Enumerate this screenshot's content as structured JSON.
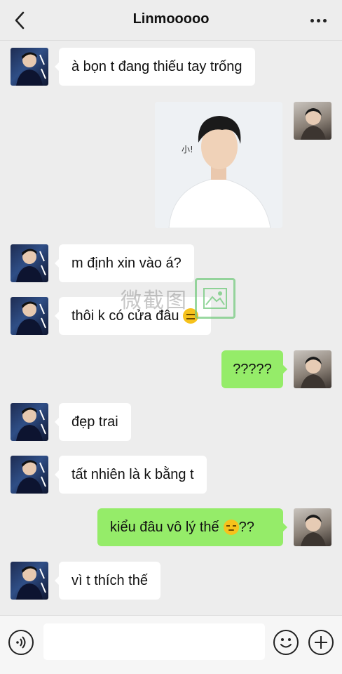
{
  "header": {
    "title": "Linmooooo"
  },
  "messages": [
    {
      "side": "left",
      "text": "à bọn t đang thiếu tay trống"
    },
    {
      "side": "right",
      "type": "image",
      "caption_in_image": "小!"
    },
    {
      "side": "left",
      "text": "m định xin vào á?"
    },
    {
      "side": "left",
      "text": "thôi k có cửa đâu",
      "emoji": "neutral-face"
    },
    {
      "side": "right",
      "text": "?????"
    },
    {
      "side": "left",
      "text": "đẹp trai"
    },
    {
      "side": "left",
      "text": "tất nhiên là k bằng t"
    },
    {
      "side": "right",
      "text": "kiểu đâu vô lý thế",
      "emoji": "unamused-face",
      "suffix": "??"
    },
    {
      "side": "left",
      "text": "vì t thích thế"
    }
  ],
  "watermark": {
    "text": "微截图"
  },
  "input": {
    "placeholder": ""
  },
  "colors": {
    "background": "#ededed",
    "sent_bubble": "#95ec69",
    "received_bubble": "#ffffff"
  }
}
